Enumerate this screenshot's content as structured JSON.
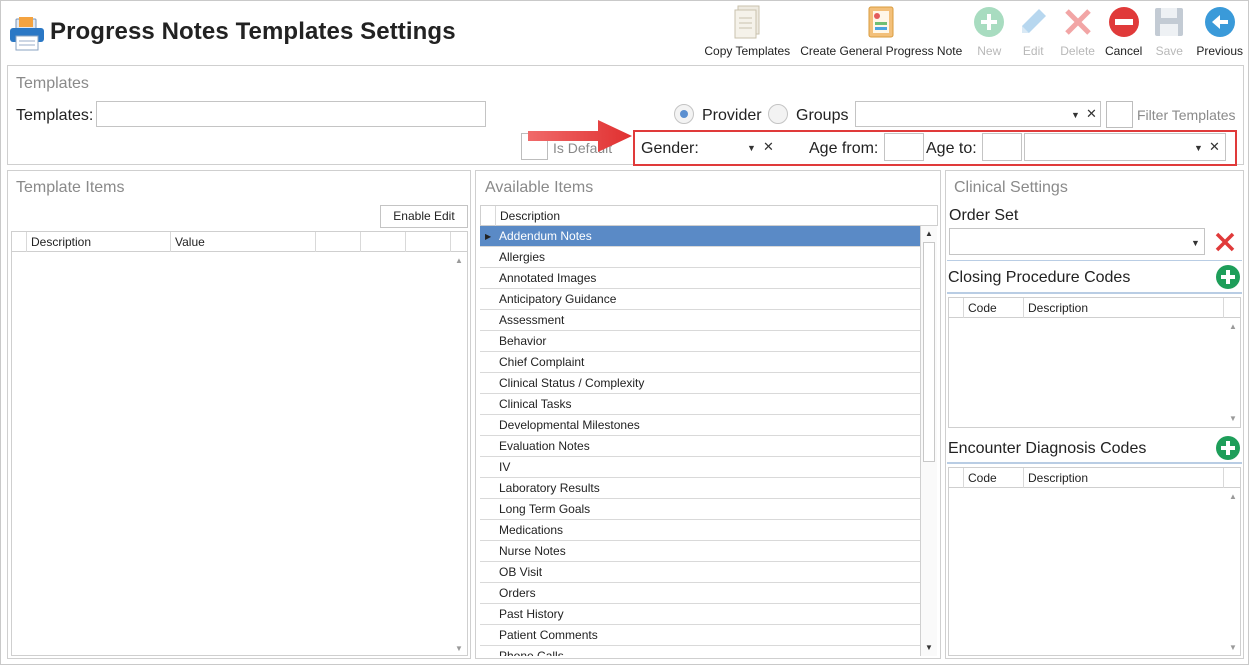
{
  "page_title": "Progress Notes Templates Settings",
  "toolbar": {
    "copy_templates": "Copy Templates",
    "create_general": "Create General Progress Note",
    "new": "New",
    "edit": "Edit",
    "delete": "Delete",
    "cancel": "Cancel",
    "save": "Save",
    "previous": "Previous"
  },
  "templates_panel": {
    "title": "Templates",
    "templates_label": "Templates:",
    "templates_value": "",
    "provider_label": "Provider",
    "groups_label": "Groups",
    "selected_scope": "Provider",
    "groups_value": "",
    "filter_templates_label": "Filter Templates",
    "is_default_label": "Is Default",
    "gender_label": "Gender:",
    "gender_value": "",
    "age_from_label": "Age from:",
    "age_from_value": "",
    "age_to_label": "Age to:",
    "age_to_value": "",
    "age_unit_value": ""
  },
  "template_items": {
    "title": "Template Items",
    "enable_edit": "Enable Edit",
    "columns": [
      "Description",
      "Value",
      "",
      "",
      ""
    ]
  },
  "available_items": {
    "title": "Available Items",
    "column": "Description",
    "selected": "Addendum Notes",
    "items": [
      "Addendum Notes",
      "Allergies",
      "Annotated Images",
      "Anticipatory Guidance",
      "Assessment",
      "Behavior",
      "Chief Complaint",
      "Clinical Status / Complexity",
      "Clinical Tasks",
      "Developmental Milestones",
      "Evaluation Notes",
      "IV",
      "Laboratory Results",
      "Long Term Goals",
      "Medications",
      "Nurse Notes",
      "OB Visit",
      "Orders",
      "Past History",
      "Patient Comments",
      "Phone Calls"
    ]
  },
  "clinical_settings": {
    "title": "Clinical Settings",
    "order_set_label": "Order Set",
    "order_set_value": "",
    "closing_label": "Closing Procedure Codes",
    "encounter_label": "Encounter Diagnosis Codes",
    "code_col": "Code",
    "desc_col": "Description"
  },
  "colors": {
    "selection": "#5a8ac6",
    "highlight_box": "#e03a3a",
    "add_green": "#1e9e5a",
    "cancel_red": "#e03a3a",
    "previous_teal": "#3a9ad9"
  }
}
